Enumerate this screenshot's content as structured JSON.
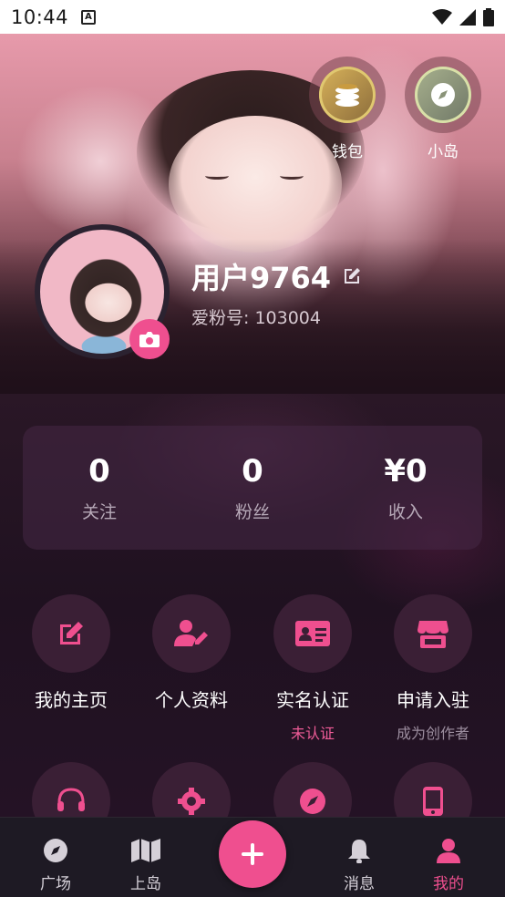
{
  "status_bar": {
    "time": "10:44",
    "notification_icon": "a-letter-icon",
    "right_icons": [
      "wifi-icon",
      "signal-icon",
      "battery-icon"
    ]
  },
  "quick_actions": {
    "wallet": {
      "label": "钱包",
      "icon": "coins-icon"
    },
    "island": {
      "label": "小岛",
      "icon": "compass-icon"
    }
  },
  "profile": {
    "username": "用户9764",
    "fan_id": "爱粉号: 103004"
  },
  "stats": [
    {
      "value": "0",
      "label": "关注"
    },
    {
      "value": "0",
      "label": "粉丝"
    },
    {
      "value": "¥0",
      "label": "收入"
    }
  ],
  "menu": {
    "home": {
      "label": "我的主页",
      "icon": "edit-icon"
    },
    "profile": {
      "label": "个人资料",
      "icon": "user-edit-icon"
    },
    "verify": {
      "label": "实名认证",
      "sub": "未认证",
      "icon": "id-card-icon"
    },
    "join": {
      "label": "申请入驻",
      "sub": "成为创作者",
      "icon": "store-icon"
    },
    "row2_icons": [
      "headset-icon",
      "gear-icon",
      "compass-icon",
      "phone-icon"
    ]
  },
  "bottom_nav": {
    "square": "广场",
    "island": "上岛",
    "messages": "消息",
    "mine": "我的"
  },
  "colors": {
    "accent": "#ef4f8f",
    "background": "#1a0f1c",
    "card": "#46284680"
  }
}
